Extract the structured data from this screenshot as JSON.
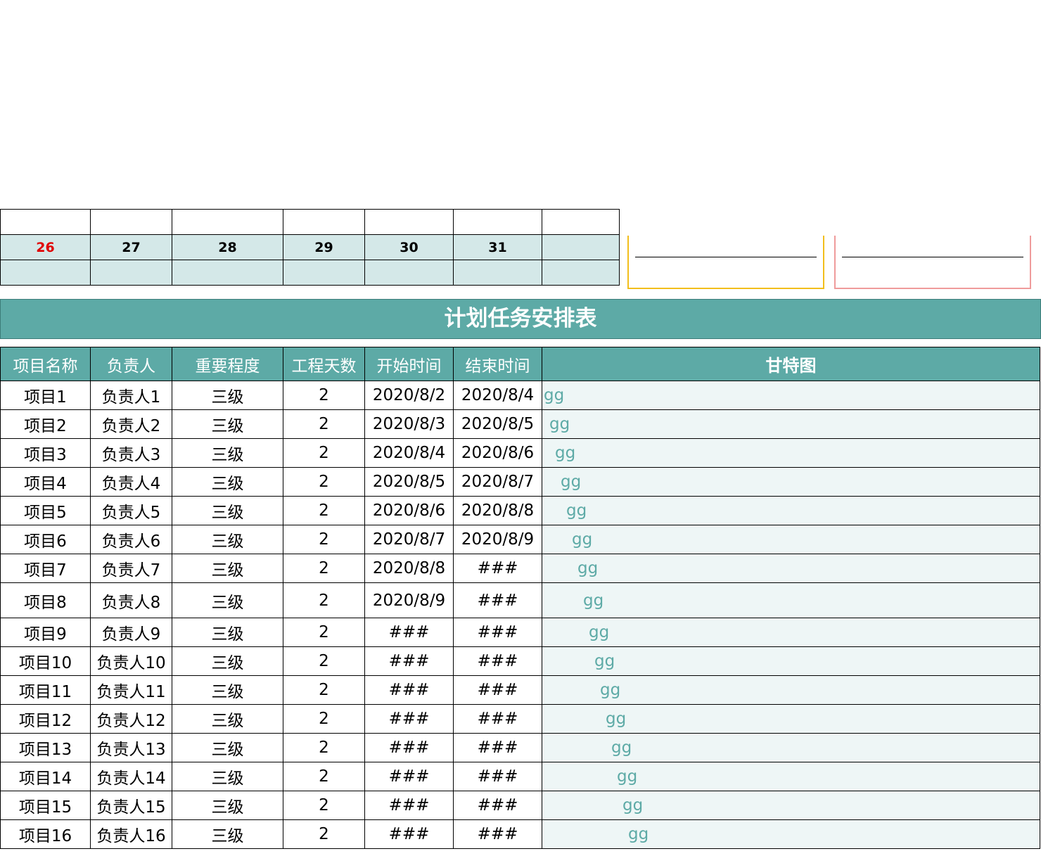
{
  "calendar": {
    "days": [
      "26",
      "27",
      "28",
      "29",
      "30",
      "31",
      ""
    ]
  },
  "title": "计划任务安排表",
  "table": {
    "headers": [
      "项目名称",
      "负责人",
      "重要程度",
      "工程天数",
      "开始时间",
      "结束时间",
      "甘特图"
    ],
    "rows": [
      {
        "name": "项目1",
        "owner": "负责人1",
        "level": "三级",
        "days": "2",
        "start": "2020/8/2",
        "end": "2020/8/4",
        "bar": "gg"
      },
      {
        "name": "项目2",
        "owner": "负责人2",
        "level": "三级",
        "days": "2",
        "start": "2020/8/3",
        "end": "2020/8/5",
        "bar": "gg"
      },
      {
        "name": "项目3",
        "owner": "负责人3",
        "level": "三级",
        "days": "2",
        "start": "2020/8/4",
        "end": "2020/8/6",
        "bar": "gg"
      },
      {
        "name": "项目4",
        "owner": "负责人4",
        "level": "三级",
        "days": "2",
        "start": "2020/8/5",
        "end": "2020/8/7",
        "bar": "gg"
      },
      {
        "name": "项目5",
        "owner": "负责人5",
        "level": "三级",
        "days": "2",
        "start": "2020/8/6",
        "end": "2020/8/8",
        "bar": "gg"
      },
      {
        "name": "项目6",
        "owner": "负责人6",
        "level": "三级",
        "days": "2",
        "start": "2020/8/7",
        "end": "2020/8/9",
        "bar": "gg"
      },
      {
        "name": "项目7",
        "owner": "负责人7",
        "level": "三级",
        "days": "2",
        "start": "2020/8/8",
        "end": "###",
        "bar": "gg"
      },
      {
        "name": "项目8",
        "owner": "负责人8",
        "level": "三级",
        "days": "2",
        "start": "2020/8/9",
        "end": "###",
        "bar": "gg"
      },
      {
        "name": "项目9",
        "owner": "负责人9",
        "level": "三级",
        "days": "2",
        "start": "###",
        "end": "###",
        "bar": "gg"
      },
      {
        "name": "项目10",
        "owner": "负责人10",
        "level": "三级",
        "days": "2",
        "start": "###",
        "end": "###",
        "bar": "gg"
      },
      {
        "name": "项目11",
        "owner": "负责人11",
        "level": "三级",
        "days": "2",
        "start": "###",
        "end": "###",
        "bar": "gg"
      },
      {
        "name": "项目12",
        "owner": "负责人12",
        "level": "三级",
        "days": "2",
        "start": "###",
        "end": "###",
        "bar": "gg"
      },
      {
        "name": "项目13",
        "owner": "负责人13",
        "level": "三级",
        "days": "2",
        "start": "###",
        "end": "###",
        "bar": "gg"
      },
      {
        "name": "项目14",
        "owner": "负责人14",
        "level": "三级",
        "days": "2",
        "start": "###",
        "end": "###",
        "bar": "gg"
      },
      {
        "name": "项目15",
        "owner": "负责人15",
        "level": "三级",
        "days": "2",
        "start": "###",
        "end": "###",
        "bar": "gg"
      },
      {
        "name": "项目16",
        "owner": "负责人16",
        "level": "三级",
        "days": "2",
        "start": "###",
        "end": "###",
        "bar": "gg"
      }
    ]
  },
  "colors": {
    "accent": "#5daaa6",
    "calendar_fill": "#d4e8e8",
    "gantt_fill": "#eef6f6",
    "box_left": "#f2be1c",
    "box_right": "#ef9b9b",
    "today": "#e00000"
  }
}
